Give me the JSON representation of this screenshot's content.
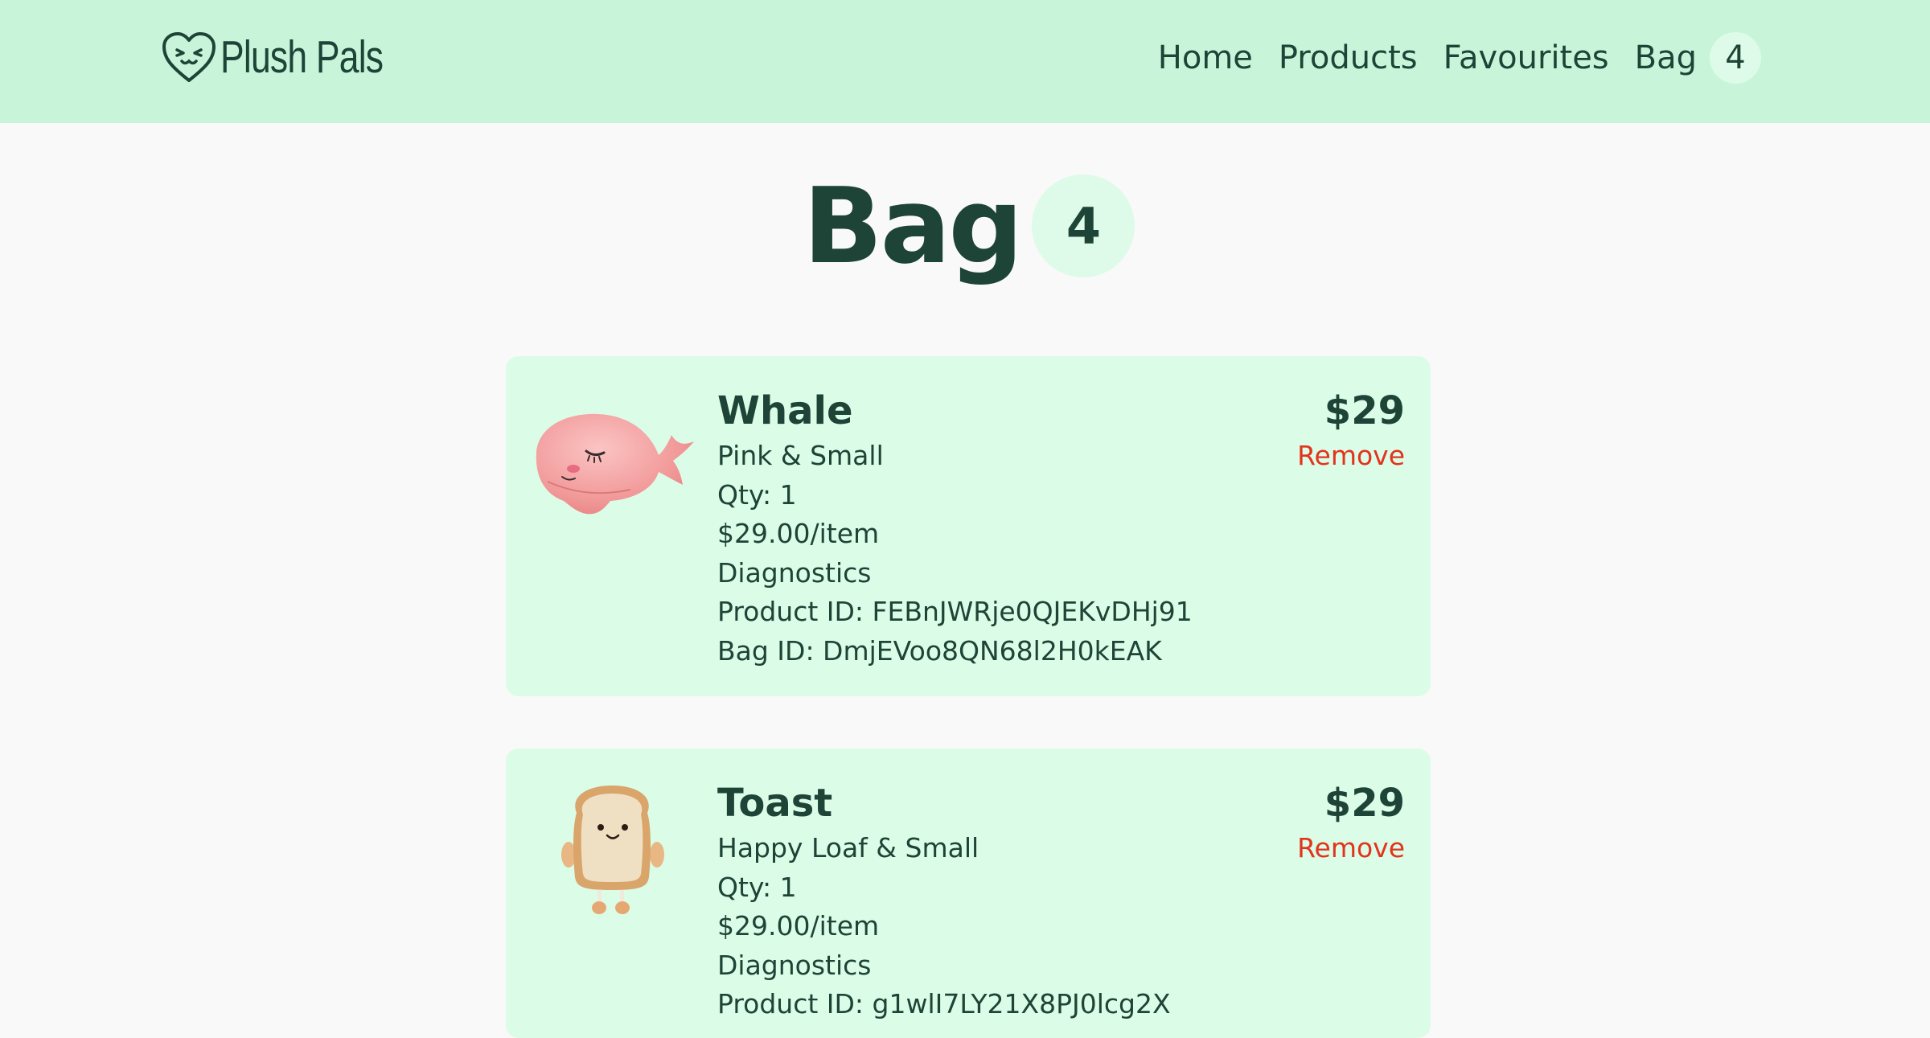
{
  "header": {
    "brand": "Plush Pals",
    "nav": {
      "home": "Home",
      "products": "Products",
      "favourites": "Favourites",
      "bag": "Bag",
      "bag_count": "4"
    }
  },
  "page": {
    "title": "Bag",
    "count": "4"
  },
  "items": [
    {
      "name": "Whale",
      "variant": "Pink & Small",
      "qty": "Qty: 1",
      "unit_price": "$29.00/item",
      "diagnostics": "Diagnostics",
      "product_id": "Product ID: FEBnJWRje0QJEKvDHj91",
      "bag_id": "Bag ID: DmjEVoo8QN68l2H0kEAK",
      "price": "$29",
      "remove": "Remove"
    },
    {
      "name": "Toast",
      "variant": "Happy Loaf & Small",
      "qty": "Qty: 1",
      "unit_price": "$29.00/item",
      "diagnostics": "Diagnostics",
      "product_id": "Product ID: g1wlI7LY21X8PJ0lcg2X",
      "price": "$29",
      "remove": "Remove"
    }
  ],
  "colors": {
    "header_bg": "#c8f5da",
    "card_bg": "#dbfce7",
    "text": "#1d4437",
    "remove": "#e2341d",
    "page_bg": "#f9f9f9"
  }
}
